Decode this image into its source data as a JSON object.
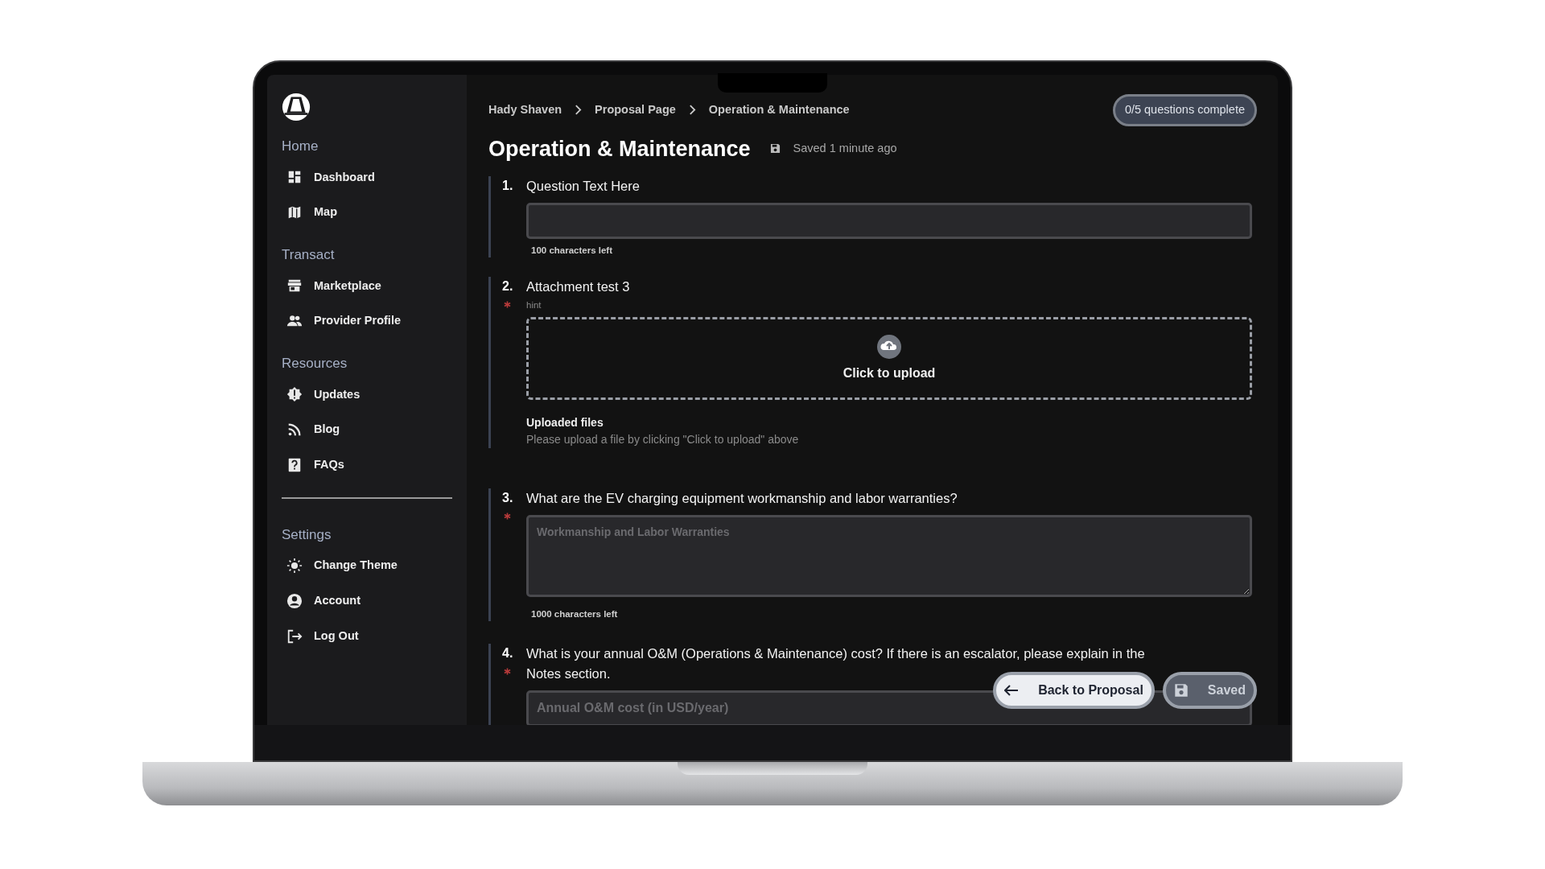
{
  "sidebar": {
    "sections": [
      {
        "kind": "group",
        "heading": "Home",
        "items": [
          {
            "label": "Dashboard"
          },
          {
            "label": "Map"
          }
        ]
      },
      {
        "kind": "group",
        "heading": "Transact",
        "items": [
          {
            "label": "Marketplace"
          },
          {
            "label": "Provider Profile"
          }
        ]
      },
      {
        "kind": "group",
        "heading": "Resources",
        "items": [
          {
            "label": "Updates"
          },
          {
            "label": "Blog"
          },
          {
            "label": "FAQs"
          }
        ]
      },
      {
        "kind": "divider"
      },
      {
        "kind": "group",
        "heading": "Settings",
        "items": [
          {
            "label": "Change Theme"
          },
          {
            "label": "Account"
          },
          {
            "label": "Log Out"
          }
        ]
      }
    ]
  },
  "breadcrumbs": [
    "Hady Shaven",
    "Proposal Page",
    "Operation & Maintenance"
  ],
  "progress": "0/5 questions complete",
  "title": "Operation & Maintenance",
  "save_status": "Saved 1 minute ago",
  "questions": [
    {
      "number": "1.",
      "text": "Question Text Here",
      "required": false,
      "kind": "text",
      "counter": "100 characters left"
    },
    {
      "number": "2.",
      "text": "Attachment test 3",
      "required": true,
      "kind": "upload",
      "hint": "hint",
      "upload_label": "Click to upload",
      "files_heading": "Uploaded files",
      "files_empty": "Please upload a file by clicking \"Click to upload\" above"
    },
    {
      "number": "3.",
      "text": "What are the EV charging equipment workmanship and labor warranties?",
      "required": true,
      "kind": "textarea",
      "placeholder": "Workmanship and Labor Warranties",
      "counter": "1000 characters left"
    },
    {
      "number": "4.",
      "text": "What is your annual O&M (Operations & Maintenance) cost? If there is an escalator, please explain in the Notes section.",
      "required": true,
      "kind": "text",
      "placeholder": "Annual O&M cost (in USD/year)"
    }
  ],
  "footer": {
    "back": "Back to Proposal",
    "saved": {
      "label": "Saved",
      "disabled": true
    }
  }
}
